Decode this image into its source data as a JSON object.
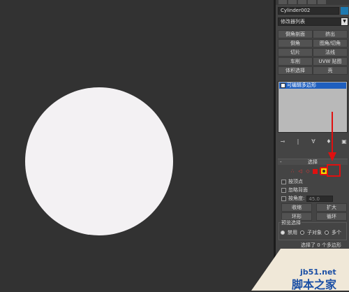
{
  "object_name": "Cylinder002",
  "modifier_list_label": "修改器列表",
  "modifier_buttons": [
    "倒角剖面",
    "挤出",
    "倒角",
    "图角/切角",
    "切片",
    "法线",
    "车削",
    "UVW 贴图",
    "体积选择",
    "壳"
  ],
  "stack": {
    "item_label": "可编辑多边形"
  },
  "selection_rollout": {
    "title": "选择",
    "minus": "-",
    "by_vertex_label": "按顶点",
    "ignore_backface_label": "忽略背面",
    "by_angle_label": "按角度:",
    "by_angle_value": "45.0",
    "shrink_label": "收缩",
    "grow_label": "扩大",
    "ring_label": "环形",
    "loop_label": "循环",
    "preview_group_label": "预览选择",
    "preview_options": [
      "禁用",
      "子对象",
      "多个"
    ],
    "preview_selected": "禁用",
    "status_text": "选择了 0 个多边形"
  },
  "watermark": {
    "site": "jb51.net",
    "name": "脚本之家"
  },
  "colors": {
    "viewport_bg": "#323232",
    "panel_bg": "#444444",
    "object_fill": "#f3f1f3",
    "highlight": "#e01010",
    "stack_selected": "#1f5fbf"
  }
}
